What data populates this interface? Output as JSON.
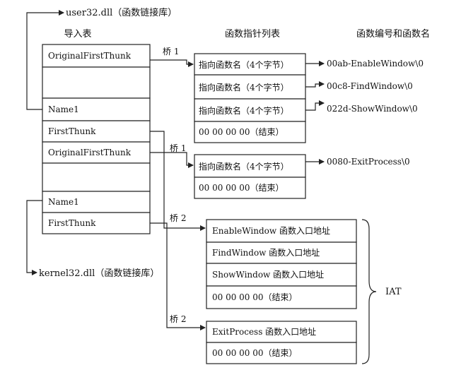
{
  "title_top": "user32.dll（函数链接库）",
  "title_bottom": "kernel32.dll（函数链接库）",
  "import_table": {
    "heading": "导入表",
    "cells": [
      "OriginalFirstThunk",
      "",
      "Name1",
      "FirstThunk",
      "OriginalFirstThunk",
      "",
      "Name1",
      "FirstThunk"
    ]
  },
  "pointer_table": {
    "heading": "函数指针列表",
    "group1": [
      "指向函数名（4个字节）",
      "指向函数名（4个字节）",
      "指向函数名（4个字节）",
      "00 00 00 00（结束）"
    ],
    "group2": [
      "指向函数名（4个字节）",
      "00 00 00 00（结束）"
    ]
  },
  "names": {
    "heading": "函数编号和函数名",
    "items": [
      "00ab-EnableWindow\\0",
      "00c8-FindWindow\\0",
      "022d-ShowWindow\\0",
      "0080-ExitProcess\\0"
    ]
  },
  "bridge_labels": [
    "桥 1",
    "桥 1",
    "桥 2",
    "桥 2"
  ],
  "iat": {
    "label": "IAT",
    "group1": [
      "EnableWindow 函数入口地址",
      "FindWindow 函数入口地址",
      "ShowWindow 函数入口地址",
      "00 00 00 00（结束）"
    ],
    "group2": [
      "ExitProcess 函数入口地址",
      "00 00 00 00（结束）"
    ]
  }
}
